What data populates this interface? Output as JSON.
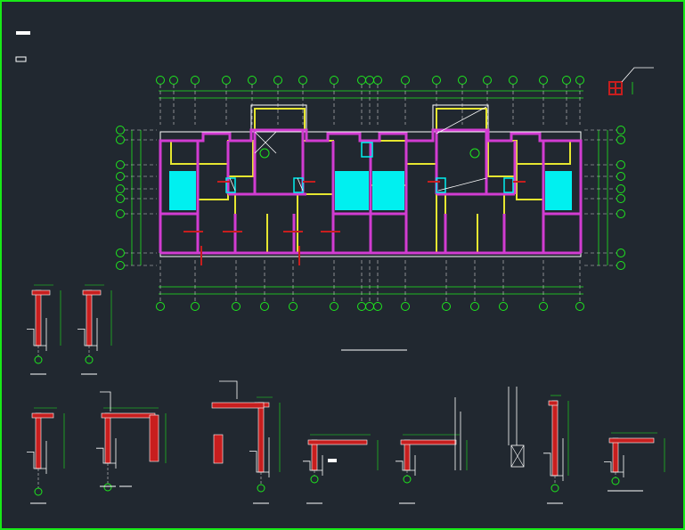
{
  "colors": {
    "background": "#212830",
    "frame": "#18e818",
    "axis_bubble": "#1ee81e",
    "wall": "#d23cd2",
    "beam": "#e6e630",
    "fill_room": "#00f0f0",
    "section": "#c81e1e",
    "outline": "#ffffff",
    "dim": "#1ee81e"
  },
  "plan": {
    "top_bubbles_count": 21,
    "left_bubbles_count": 9,
    "right_bubbles_count": 9,
    "bottom_bubbles_count": 16
  },
  "details": {
    "top_small_count": 2,
    "bottom_count": 8
  }
}
